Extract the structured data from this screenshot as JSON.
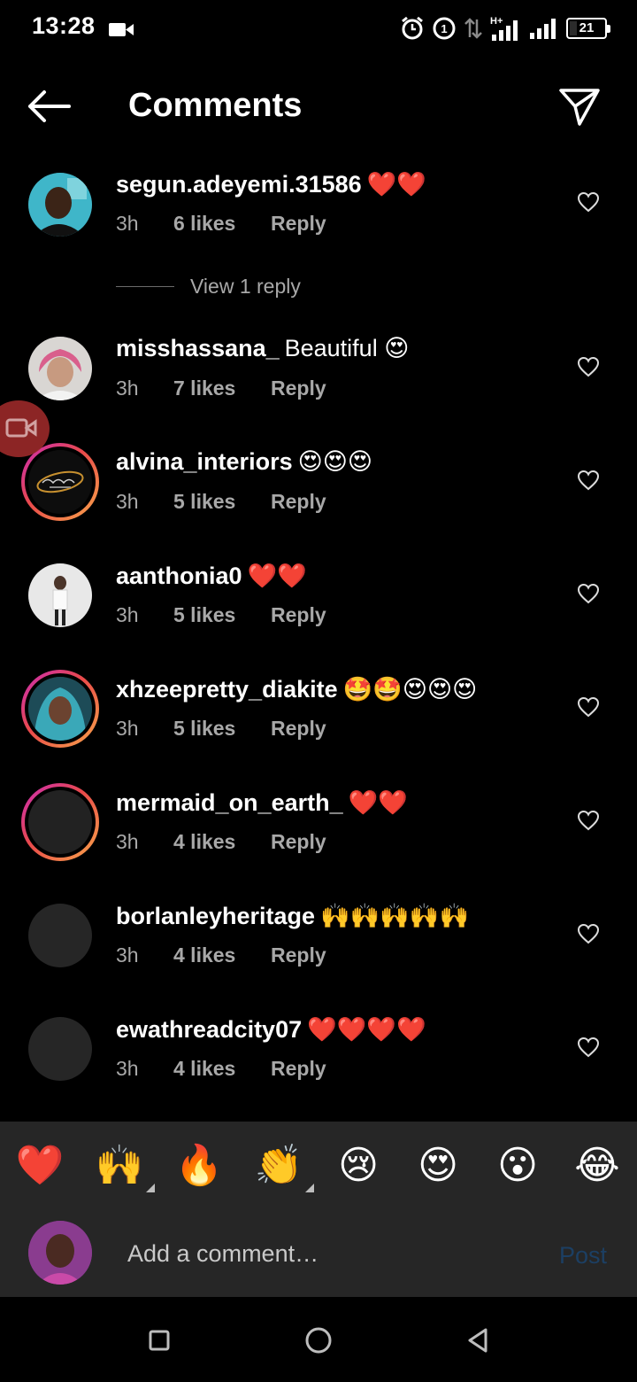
{
  "status_bar": {
    "time": "13:28",
    "battery": "21",
    "icons": [
      "video-camera-icon",
      "alarm-icon",
      "sim-icon",
      "data-arrows-icon",
      "signal-h-plus-icon",
      "signal-icon",
      "battery-icon"
    ],
    "network": "H+"
  },
  "header": {
    "title": "Comments",
    "back_icon": "arrow-left-icon",
    "share_icon": "paper-plane-icon"
  },
  "comments": [
    {
      "username": "segun.adeyemi.31586",
      "text": "❤️❤️",
      "time": "3h",
      "likes": "6 likes",
      "reply": "Reply",
      "view_replies": "View 1 reply"
    },
    {
      "username": "misshassana_",
      "text": "Beautiful 😍",
      "time": "3h",
      "likes": "7 likes",
      "reply": "Reply"
    },
    {
      "username": "alvina_interiors",
      "text": "😍😍😍",
      "time": "3h",
      "likes": "5 likes",
      "reply": "Reply"
    },
    {
      "username": "aanthonia0",
      "text": "❤️❤️",
      "time": "3h",
      "likes": "5 likes",
      "reply": "Reply"
    },
    {
      "username": "xhzeepretty_diakite",
      "text": "🤩🤩😍😍😍",
      "time": "3h",
      "likes": "5 likes",
      "reply": "Reply"
    },
    {
      "username": "mermaid_on_earth_",
      "text": "❤️❤️",
      "time": "3h",
      "likes": "4 likes",
      "reply": "Reply"
    },
    {
      "username": "borlanleyheritage",
      "text": "🙌🙌🙌🙌🙌",
      "time": "3h",
      "likes": "4 likes",
      "reply": "Reply"
    },
    {
      "username": "ewathreadcity07",
      "text": "❤️❤️❤️❤️",
      "time": "3h",
      "likes": "4 likes",
      "reply": "Reply"
    }
  ],
  "emoji_bar": [
    "❤️",
    "🙌",
    "🔥",
    "👏",
    "😢",
    "😍",
    "😮",
    "😂"
  ],
  "input": {
    "placeholder": "Add a comment…",
    "post_label": "Post"
  },
  "colors": {
    "background": "#000000",
    "panel": "#262626",
    "secondary_text": "#a8a8a8",
    "post_disabled": "#1c3f63",
    "story_ring_start": "#c92bb7",
    "story_ring_end": "#f9a74a"
  },
  "nav_bar": {
    "icons": [
      "square-recents-icon",
      "circle-home-icon",
      "triangle-back-icon"
    ]
  }
}
